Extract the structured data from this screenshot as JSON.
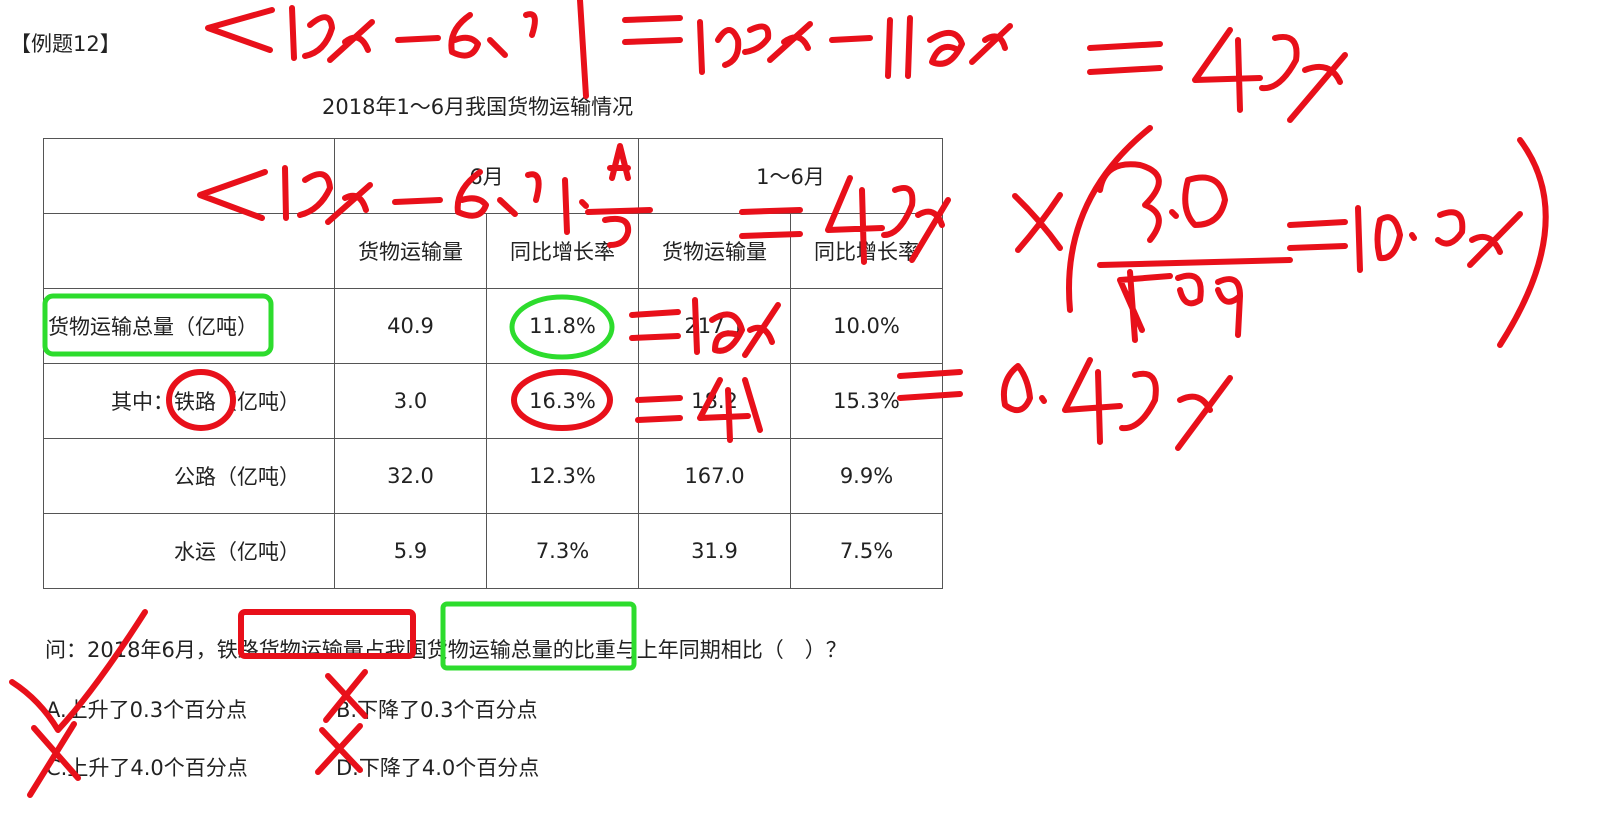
{
  "example_label": "【例题12】",
  "table": {
    "title": "2018年1～6月我国货物运输情况",
    "period_headers": [
      "6月",
      "1～6月"
    ],
    "sub_headers": [
      "货物运输量",
      "同比增长率",
      "货物运输量",
      "同比增长率"
    ],
    "rows": [
      {
        "label": "货物运输总量（亿吨）",
        "cells": [
          "40.9",
          "11.8%",
          "217.1",
          "10.0%"
        ]
      },
      {
        "label": "其中：铁路（亿吨）",
        "cells": [
          "3.0",
          "16.3%",
          "18.2",
          "15.3%"
        ]
      },
      {
        "label": "公路（亿吨）",
        "cells": [
          "32.0",
          "12.3%",
          "167.0",
          "9.9%"
        ]
      },
      {
        "label": "水运（亿吨）",
        "cells": [
          "5.9",
          "7.3%",
          "31.9",
          "7.5%"
        ]
      }
    ]
  },
  "question": "问：2018年6月，铁路货物运输量占我国货物运输总量的比重与上年同期相比（　）？",
  "options": {
    "a": "A.上升了0.3个百分点",
    "b": "B.下降了0.3个百分点",
    "c": "C.上升了4.0个百分点",
    "d": "D.下降了4.0个百分点"
  },
  "annotation_colors": {
    "red_ink": "#e8101a",
    "green_ink": "#2ddc2d"
  }
}
